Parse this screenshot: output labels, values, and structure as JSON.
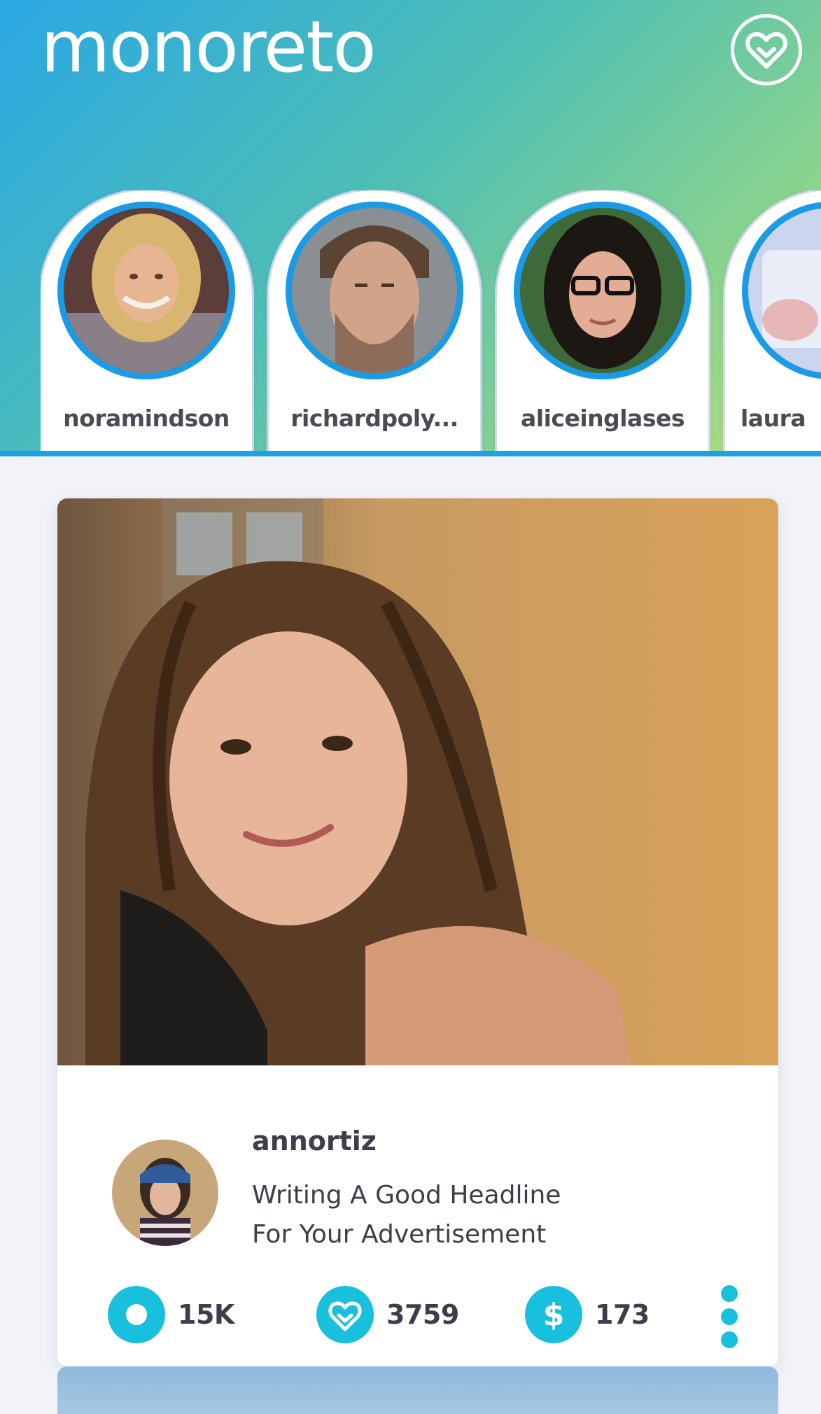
{
  "header": {
    "logo": "monoreto",
    "favorites_icon": "heart-circle-icon"
  },
  "stories": [
    {
      "username": "noramindson"
    },
    {
      "username": "richardpoly..."
    },
    {
      "username": "aliceinglases"
    },
    {
      "username": "laura"
    }
  ],
  "post": {
    "author": "annortiz",
    "headline_line1": "Writing A Good Headline",
    "headline_line2": "For Your Advertisement",
    "stats": {
      "views": "15K",
      "likes": "3759",
      "money": "173"
    }
  },
  "colors": {
    "accent": "#19c0dd",
    "story_ring": "#1a9be6",
    "text": "#3c3f4a"
  }
}
